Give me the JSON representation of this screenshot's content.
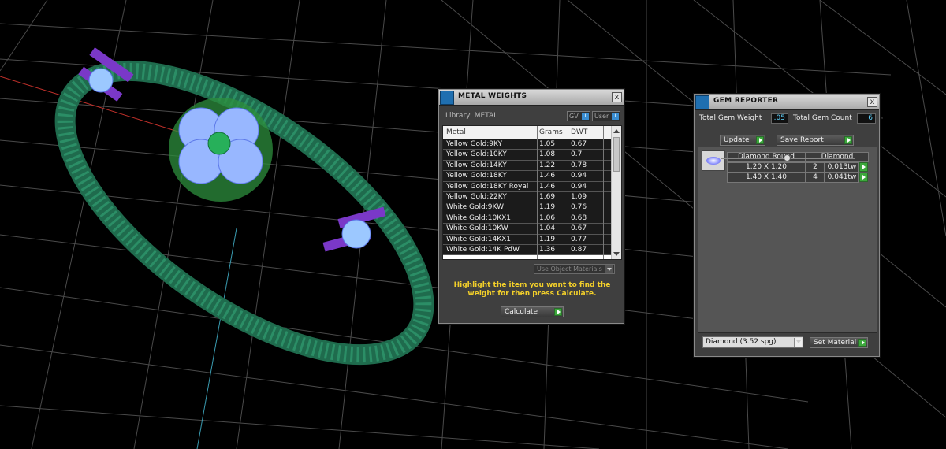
{
  "colors": {
    "accent_green": "#3ca83c",
    "warning_yellow": "#f2cf2a",
    "value_cyan": "#5fd4ff",
    "ring_green": "#2a8f63",
    "gem_blue": "#8ab4ff",
    "prong_purple": "#7a38c8"
  },
  "metal_weights": {
    "title": "METAL WEIGHTS",
    "library_label": "Library: METAL",
    "gv_label": "GV",
    "user_label": "User",
    "toggle_indicator": "i",
    "close_label": "x",
    "columns": [
      "Metal",
      "Grams",
      "DWT"
    ],
    "rows": [
      {
        "metal": "Yellow Gold:9KY",
        "grams": "1.05",
        "dwt": "0.67"
      },
      {
        "metal": "Yellow Gold:10KY",
        "grams": "1.08",
        "dwt": "0.7"
      },
      {
        "metal": "Yellow Gold:14KY",
        "grams": "1.22",
        "dwt": "0.78"
      },
      {
        "metal": "Yellow Gold:18KY",
        "grams": "1.46",
        "dwt": "0.94"
      },
      {
        "metal": "Yellow Gold:18KY Royal",
        "grams": "1.46",
        "dwt": "0.94"
      },
      {
        "metal": "Yellow Gold:22KY",
        "grams": "1.69",
        "dwt": "1.09"
      },
      {
        "metal": "White Gold:9KW",
        "grams": "1.19",
        "dwt": "0.76"
      },
      {
        "metal": "White Gold:10KX1",
        "grams": "1.06",
        "dwt": "0.68"
      },
      {
        "metal": "White Gold:10KW",
        "grams": "1.04",
        "dwt": "0.67"
      },
      {
        "metal": "White Gold:14KX1",
        "grams": "1.19",
        "dwt": "0.77"
      },
      {
        "metal": "White Gold:14K PdW",
        "grams": "1.36",
        "dwt": "0.87"
      }
    ],
    "use_object_materials": "Use Object Materials",
    "message": "Highlight the item you want to find the weight for then press Calculate.",
    "calculate_label": "Calculate"
  },
  "gem_reporter": {
    "title": "GEM REPORTER",
    "close_label": "x",
    "total_weight_label": "Total Gem Weight",
    "total_weight_value": ".05",
    "total_count_label": "Total Gem Count",
    "total_count_value": "6",
    "update_label": "Update",
    "save_report_label": "Save Report",
    "table_headers": [
      "Diamond Round",
      "Diamond"
    ],
    "gems": [
      {
        "size": "1.20 X 1.20",
        "count": "2",
        "weight": "0.013tw"
      },
      {
        "size": "1.40 X 1.40",
        "count": "4",
        "weight": "0.041tw"
      }
    ],
    "material_select": "Diamond    (3.52 spg)",
    "set_material_label": "Set Material"
  }
}
